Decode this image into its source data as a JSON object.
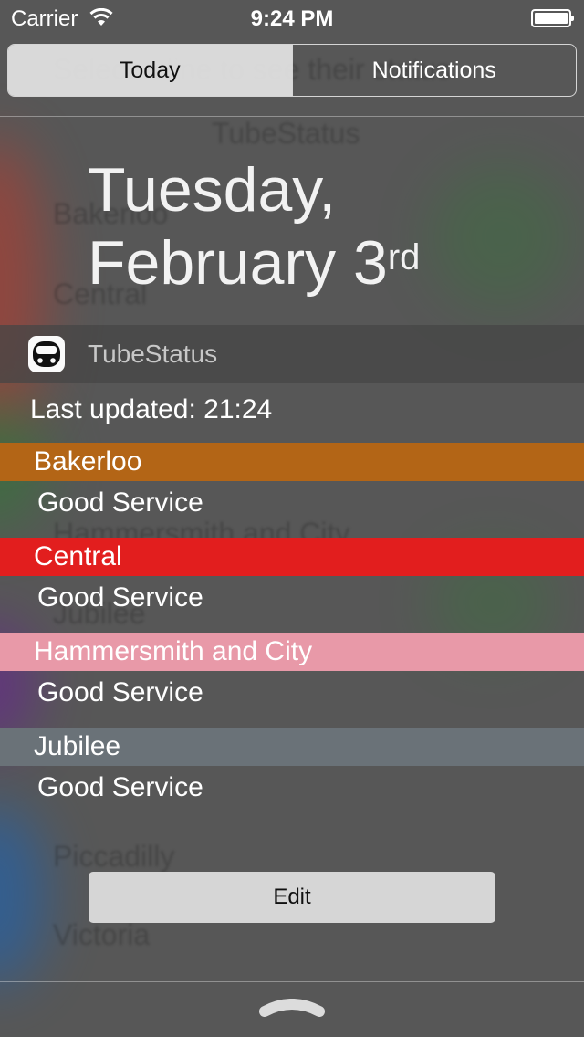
{
  "status_bar": {
    "carrier": "Carrier",
    "time": "9:24 PM"
  },
  "tabs": [
    {
      "label": "Today",
      "active": true
    },
    {
      "label": "Notifications",
      "active": false
    }
  ],
  "date": {
    "line1": "Tuesday,",
    "line2": "February 3",
    "suffix": "rd"
  },
  "widget": {
    "app_name": "TubeStatus",
    "icon": "tube-train-icon",
    "last_updated": "Last updated: 21:24",
    "lines": [
      {
        "name": "Bakerloo",
        "status": "Good Service",
        "color": "#B36516"
      },
      {
        "name": "Central",
        "status": "Good Service",
        "color": "#E21E1E"
      },
      {
        "name": "Hammersmith and City",
        "status": "Good Service",
        "color": "#E899A8"
      },
      {
        "name": "Jubilee",
        "status": "Good Service",
        "color": "#6A7278"
      }
    ]
  },
  "edit_label": "Edit",
  "colors": {
    "panel_bg": "#575757",
    "segment_active": "#E8E8E8",
    "edit_button": "#D6D6D6"
  }
}
